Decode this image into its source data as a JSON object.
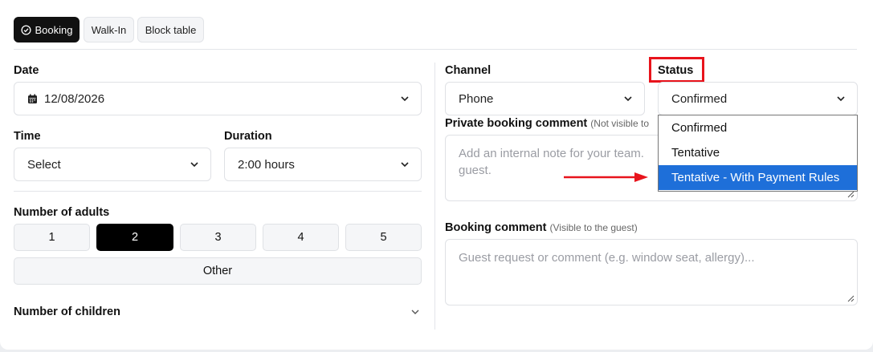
{
  "tabs": [
    {
      "label": "Booking"
    },
    {
      "label": "Walk-In"
    },
    {
      "label": "Block table"
    }
  ],
  "date": {
    "label": "Date",
    "value": "12/08/2026"
  },
  "time": {
    "label": "Time",
    "value": "Select"
  },
  "duration": {
    "label": "Duration",
    "value": "2:00 hours"
  },
  "adults": {
    "label": "Number of adults",
    "options": [
      "1",
      "2",
      "3",
      "4",
      "5"
    ],
    "selected": "2",
    "other_label": "Other"
  },
  "children": {
    "label": "Number of children"
  },
  "channel": {
    "label": "Channel",
    "value": "Phone"
  },
  "status": {
    "label": "Status",
    "value": "Confirmed",
    "options": [
      "Confirmed",
      "Tentative",
      "Tentative - With Payment Rules"
    ],
    "highlighted": "Tentative - With Payment Rules"
  },
  "private_comment": {
    "label": "Private booking comment",
    "note": "(Not visible to",
    "placeholder": "Add an internal note for your team.\nguest."
  },
  "booking_comment": {
    "label": "Booking comment",
    "note": "(Visible to the guest)",
    "placeholder": "Guest request or comment (e.g. window seat, allergy)..."
  },
  "colors": {
    "accent": "#1e6fd9",
    "annotation": "#e8141c",
    "selected": "#000000"
  }
}
